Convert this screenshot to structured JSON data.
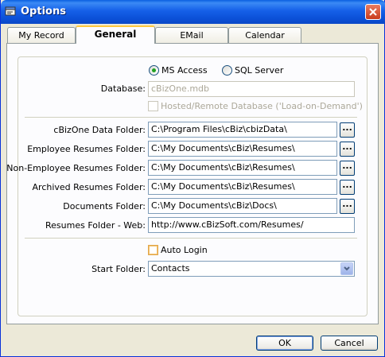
{
  "window": {
    "title": "Options"
  },
  "tabs": [
    {
      "label": "My Record"
    },
    {
      "label": "General"
    },
    {
      "label": "EMail"
    },
    {
      "label": "Calendar"
    }
  ],
  "database": {
    "options": [
      "MS Access",
      "SQL Server"
    ],
    "selected": "MS Access",
    "label": "Database:",
    "value": "cBizOne.mdb",
    "hosted_label": "Hosted/Remote Database ('Load-on-Demand')",
    "hosted_checked": false
  },
  "folders": [
    {
      "label": "cBizOne Data Folder:",
      "value": "C:\\Program Files\\cBiz\\cbizData\\",
      "browse": "..."
    },
    {
      "label": "Employee Resumes Folder:",
      "value": "C:\\My Documents\\cBiz\\Resumes\\",
      "browse": "..."
    },
    {
      "label": "Non-Employee Resumes Folder:",
      "value": "C:\\My Documents\\cBiz\\Resumes\\",
      "browse": "..."
    },
    {
      "label": "Archived Resumes Folder:",
      "value": "C:\\My Documents\\cBiz\\Resumes\\",
      "browse": "..."
    },
    {
      "label": "Documents Folder:",
      "value": "C:\\My Documents\\cBiz\\Docs\\",
      "browse": "..."
    }
  ],
  "web_folder": {
    "label": "Resumes Folder - Web:",
    "value": "http://www.cBizSoft.com/Resumes/"
  },
  "auto_login": {
    "label": "Auto Login",
    "checked": false
  },
  "start_folder": {
    "label": "Start Folder:",
    "value": "Contacts"
  },
  "buttons": {
    "ok": "OK",
    "cancel": "Cancel"
  },
  "colors": {
    "titlebar": "#0a5fe0",
    "dialog_bg": "#ece9d8",
    "tab_highlight": "#ffc83c",
    "radio_dot": "#21a121"
  }
}
